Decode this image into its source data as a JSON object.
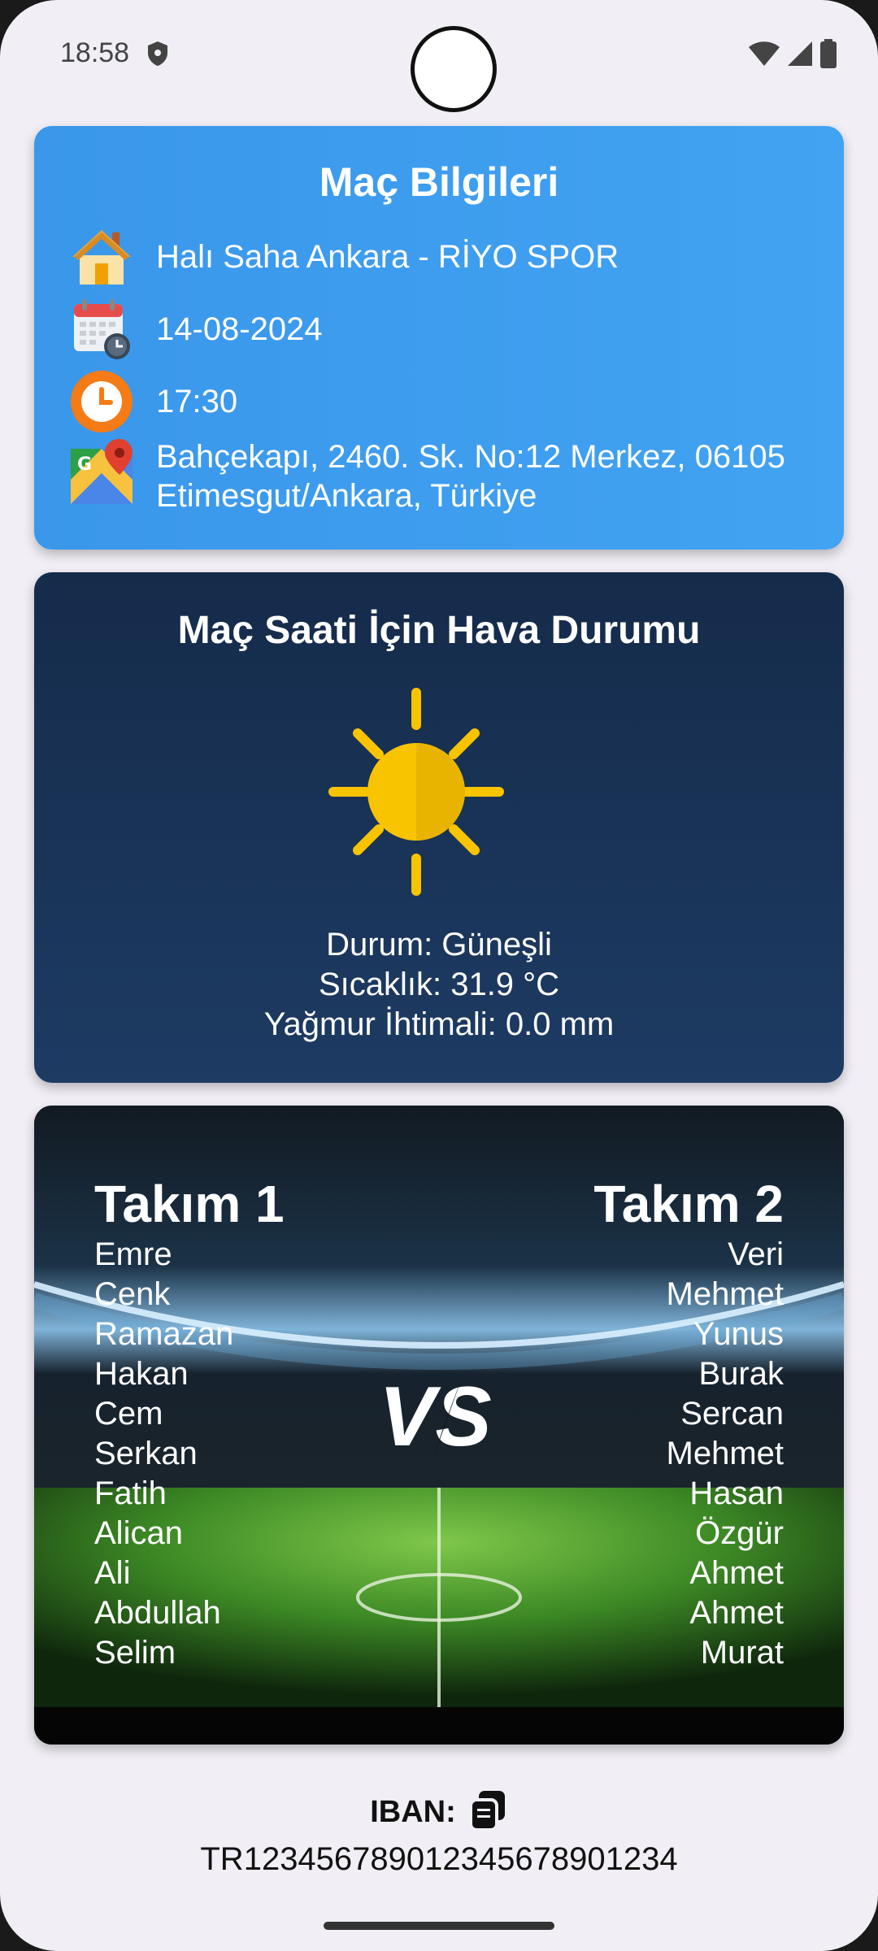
{
  "status_bar": {
    "time": "18:58"
  },
  "match_info": {
    "title": "Maç Bilgileri",
    "venue": "Halı Saha Ankara - RİYO SPOR",
    "date": "14-08-2024",
    "time": "17:30",
    "address": "Bahçekapı, 2460. Sk. No:12 Merkez, 06105 Etimesgut/Ankara, Türkiye"
  },
  "weather": {
    "title": "Maç Saati İçin Hava Durumu",
    "condition": "Durum: Güneşli",
    "temperature": "Sıcaklık: 31.9 °C",
    "rain": "Yağmur İhtimali: 0.0 mm"
  },
  "teams": {
    "vs_label": "VS",
    "team1": {
      "name": "Takım 1",
      "players": [
        "Emre",
        "Cenk",
        "Ramazan",
        "Hakan",
        "Cem",
        "Serkan",
        "Fatih",
        "Alican",
        "Ali",
        "Abdullah",
        "Selim"
      ]
    },
    "team2": {
      "name": "Takım 2",
      "players": [
        "Veri",
        "Mehmet",
        "Yunus",
        "Burak",
        "Sercan",
        "Mehmet",
        "Hasan",
        "Özgür",
        "Ahmet",
        "Ahmet",
        "Murat"
      ]
    }
  },
  "iban": {
    "label": "IBAN:",
    "value": "TR1234567890123456789012​34"
  },
  "colors": {
    "info_card": "#3a97ea",
    "weather_card": "#152b4a",
    "sun": "#f8c400"
  },
  "icons": [
    "shield-icon",
    "wifi-icon",
    "signal-icon",
    "battery-icon",
    "home-icon",
    "calendar-icon",
    "clock-icon",
    "maps-pin-icon",
    "sun-icon",
    "copy-icon"
  ]
}
